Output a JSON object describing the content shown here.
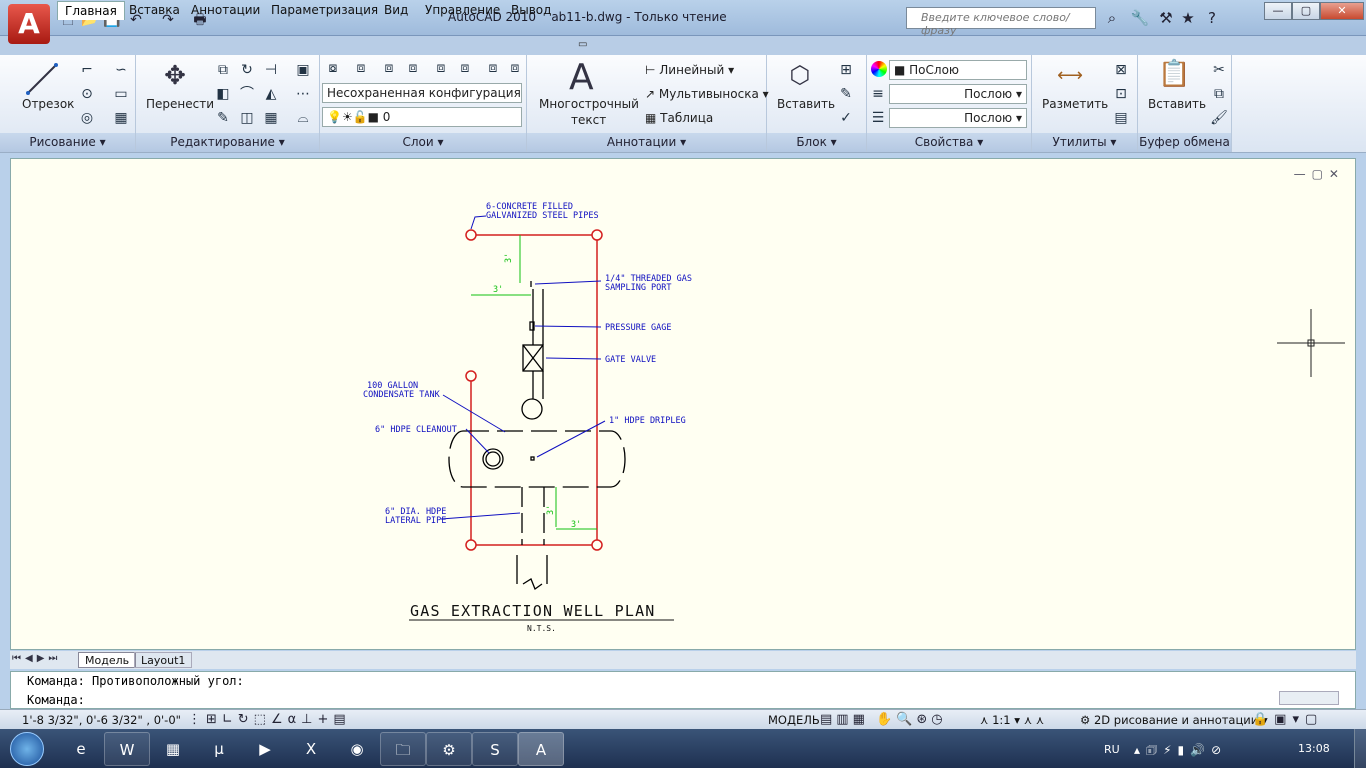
{
  "window": {
    "app_title": "AutoCAD 2010",
    "doc_title": "ab11-b.dwg - Только чтение",
    "search_placeholder": "Введите ключевое слово/фразу"
  },
  "ribbon_tabs": [
    "Главная",
    "Вставка",
    "Аннотации",
    "Параметризация",
    "Вид",
    "Управление",
    "Вывод"
  ],
  "panels": {
    "draw": {
      "title": "Рисование",
      "line_label": "Отрезок"
    },
    "modify": {
      "title": "Редактирование",
      "move_label": "Перенести"
    },
    "layers": {
      "title": "Слои",
      "layer_state": "Несохраненная конфигурация сл",
      "current_layer": "0"
    },
    "annotation": {
      "title": "Аннотации",
      "mtext_label_1": "Многострочный",
      "mtext_label_2": "текст",
      "linear": "Линейный",
      "multileader": "Мультивыноска",
      "table": "Таблица"
    },
    "block": {
      "title": "Блок",
      "insert_label": "Вставить"
    },
    "properties": {
      "title": "Свойства",
      "color": "ПоСлою",
      "lineweight": "Послою",
      "linetype": "Послою"
    },
    "utilities": {
      "title": "Утилиты",
      "measure_label": "Разметить"
    },
    "clipboard": {
      "title": "Буфер обмена",
      "paste_label": "Вставить"
    }
  },
  "drawing": {
    "title": "GAS EXTRACTION WELL PLAN",
    "subtitle": "N.T.S.",
    "labels": {
      "pipes_1": "6-CONCRETE FILLED",
      "pipes_2": "GALVANIZED STEEL PIPES",
      "sampling_1": "1/4\" THREADED GAS",
      "sampling_2": "SAMPLING PORT",
      "gage": "PRESSURE GAGE",
      "valve": "GATE VALVE",
      "tank_1": "100 GALLON",
      "tank_2": "CONDENSATE TANK",
      "cleanout": "6\" HDPE CLEANOUT",
      "dripleg": "1\" HDPE DRIPLEG",
      "lateral_1": "6\" DIA. HDPE",
      "lateral_2": "LATERAL PIPE",
      "dim_3a": "3'",
      "dim_3b": "3'",
      "dim_3c": "3'",
      "dim_3d": "3'"
    }
  },
  "layout_tabs": {
    "model": "Модель",
    "layout1": "Layout1"
  },
  "command_line": {
    "line1": "Команда: Противоположный угол:",
    "line2": "Команда:"
  },
  "status_bar": {
    "coords": "1'-8 3/32\",  0'-6 3/32\" , 0'-0\"",
    "model": "МОДЕЛЬ",
    "scale": "1:1",
    "workspace": "2D рисование и аннотации"
  },
  "taskbar": {
    "lang": "RU",
    "time": "13:08"
  },
  "colors": {
    "accent_red": "#d42020",
    "dim_green": "#10c010",
    "leader_blue": "#1010c0",
    "canvas": "#fffff2"
  }
}
